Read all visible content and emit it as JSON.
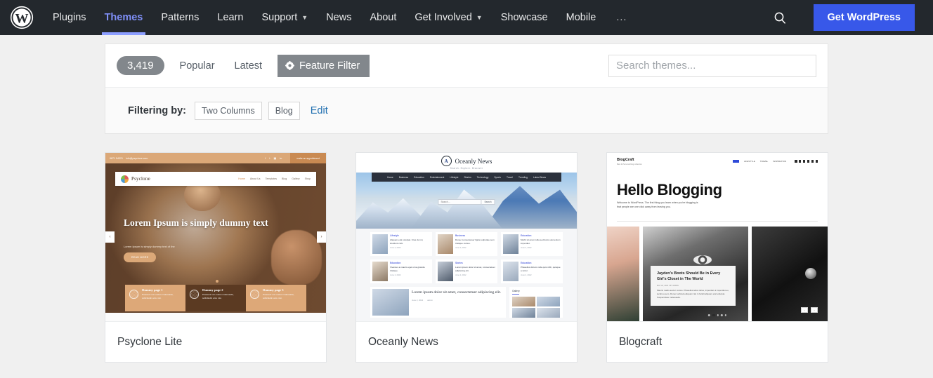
{
  "nav": {
    "logo_icon": "wordpress-logo-icon",
    "items": [
      {
        "label": "Plugins",
        "active": false,
        "has_caret": false
      },
      {
        "label": "Themes",
        "active": true,
        "has_caret": false
      },
      {
        "label": "Patterns",
        "active": false,
        "has_caret": false
      },
      {
        "label": "Learn",
        "active": false,
        "has_caret": false
      },
      {
        "label": "Support",
        "active": false,
        "has_caret": true
      },
      {
        "label": "News",
        "active": false,
        "has_caret": false
      },
      {
        "label": "About",
        "active": false,
        "has_caret": false
      },
      {
        "label": "Get Involved",
        "active": false,
        "has_caret": true
      },
      {
        "label": "Showcase",
        "active": false,
        "has_caret": false
      },
      {
        "label": "Mobile",
        "active": false,
        "has_caret": false
      }
    ],
    "overflow_label": "...",
    "search_icon": "search-icon",
    "cta_label": "Get WordPress",
    "cta_color": "#3858e9",
    "background": "#23282d",
    "active_color": "#7f8ff7"
  },
  "toolbar": {
    "count": "3,419",
    "popular_label": "Popular",
    "latest_label": "Latest",
    "feature_filter_label": "Feature Filter",
    "feature_filter_icon": "gear-icon",
    "search_placeholder": "Search themes...",
    "search_value": ""
  },
  "filtering": {
    "label": "Filtering by:",
    "tags": [
      "Two Columns",
      "Blog"
    ],
    "edit_label": "Edit",
    "edit_color": "#2271b1"
  },
  "themes": [
    {
      "name": "Psyclone Lite",
      "preview": {
        "topbar": {
          "phone": "9871 54321",
          "email": "info@psyclone.com",
          "cta": "make an appointment"
        },
        "brand": "Psyclone",
        "menu": [
          "Home",
          "About Us",
          "Templates",
          "Blog",
          "Gallery",
          "Shop"
        ],
        "hero_title": "Lorem Ipsum is simply dummy text",
        "hero_sub": "Lorem Ipsum is simply dummy text of the",
        "hero_button": "READ MORE",
        "arrow_prev": "‹",
        "arrow_next": "›",
        "cards": [
          {
            "title": "Dummy page 1",
            "text": "Praesent non metus malesuada, sollicitudin arcu nisi."
          },
          {
            "title": "Dummy page 2",
            "text": "Praesent non metus malesuada, sollicitudin arcu nisi."
          },
          {
            "title": "Dummy page 3",
            "text": "Praesent non metus malesuada, sollicitudin arcu nisi."
          }
        ]
      }
    },
    {
      "name": "Oceanly News",
      "preview": {
        "mark": "A",
        "title": "Oceanly News",
        "tagline": "Search. Explore. Discover",
        "menu": [
          "Home",
          "Business",
          "Education",
          "Entertainment",
          "Lifestyle",
          "Stories",
          "Technology",
          "Sports",
          "Travel",
          "Trending",
          "Latest News"
        ],
        "search_placeholder": "Search ...",
        "search_button": "Search",
        "posts": [
          {
            "cat": "Lifestyle",
            "title": "Aliquam erat volutpat. Cras dui mi, tincidunt cubi.",
            "date": "June 2, 2022"
          },
          {
            "cat": "Business",
            "title": "Donec consectetuer ligula vulputate sem tristique cursus.",
            "date": "June 2, 2022"
          },
          {
            "cat": "Education",
            "title": "Morbi sit amet nulla sed dolor elementum imperdiet.",
            "date": "June 2, 2022"
          },
          {
            "cat": "Education",
            "title": "Vivamus a mauris eget urna gravida tristique.",
            "date": "June 2, 2022"
          },
          {
            "cat": "Stories",
            "title": "Lorem ipsum dolor sit amet, consectetuer adipiscing elit.",
            "date": "June 2, 2022"
          },
          {
            "cat": "Education",
            "title": "Phasellus dictum nulla quis nibh, quisque a tortor.",
            "date": "June 2, 2022"
          }
        ],
        "feature": {
          "title": "Lorem ipsum dolor sit amet, consectetuer adipiscing elit.",
          "date": "June 2, 2022",
          "author": "admin"
        },
        "gallery_title": "Gallery"
      }
    },
    {
      "name": "Blogcraft",
      "preview": {
        "logo": "BlogCraft",
        "tagline": "Best & Personal blog collection",
        "menu": [
          "LIFESTYLE",
          "TRAVEL",
          "INSPIRATION"
        ],
        "heading": "Hello Blogging",
        "paragraph": "Welcome to WordPress. The first thing you learn when you're blogging is that people are one click away from leaving you.",
        "caption_title": "Jayden's Boots Should Be in Every Girl's Closet in The World",
        "caption_byline": "MAY 22, 2021 / BY ADMIN",
        "caption_text": "Mauris mattis auctor cursus. Phasellus tellus tellus, imperdiet ut imperdiet eu, iaculis a sem. Donec vehicula aliquam nisi in fandit aliquam erat volutpat. Suspendisse malesuada.",
        "pager_prev": "‹",
        "pager_next": "›"
      }
    }
  ]
}
